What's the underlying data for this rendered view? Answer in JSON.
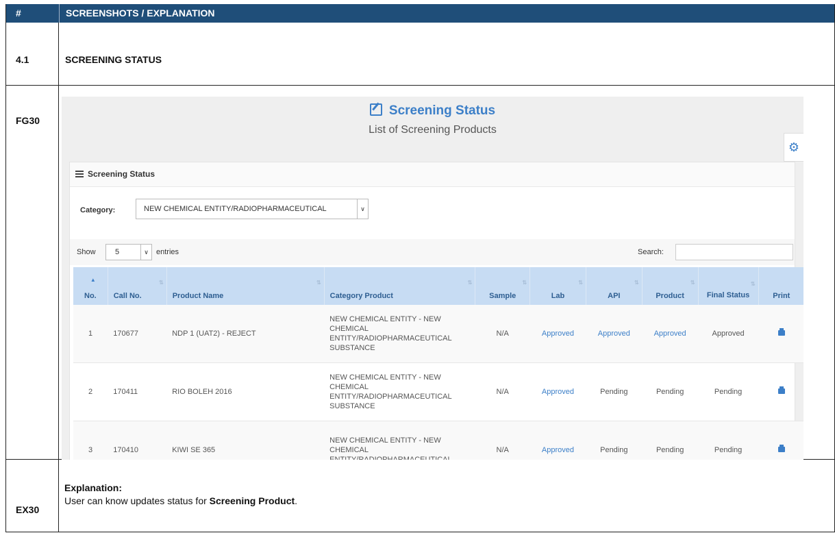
{
  "doc": {
    "col1_header": "#",
    "col2_header": "SCREENSHOTS / EXPLANATION",
    "section_num": "4.1",
    "section_title": "SCREENING STATUS",
    "fig_label": "FG30",
    "ex_label": "EX30",
    "explain_heading": "Explanation:",
    "explain_prefix": "User can know updates status for ",
    "explain_bold": "Screening Product",
    "explain_suffix": "."
  },
  "app": {
    "title": "Screening Status",
    "subtitle": "List of Screening Products",
    "panel_title": "Screening Status",
    "category_label": "Category:",
    "category_value": "NEW CHEMICAL ENTITY/RADIOPHARMACEUTICAL",
    "show_label": "Show",
    "entries_value": "5",
    "entries_label": "entries",
    "search_label": "Search:",
    "colors": {
      "accent": "#3c7fc8",
      "header_bg": "#1f4e79",
      "th_bg": "#c7dcf3"
    },
    "icons": [
      "edit-icon",
      "gear-icon",
      "list-icon",
      "print-icon",
      "sort-icon"
    ]
  },
  "table": {
    "headers": [
      "No.",
      "Call No.",
      "Product Name",
      "Category Product",
      "Sample",
      "Lab",
      "API",
      "Product",
      "Final Status",
      "Print"
    ],
    "rows": [
      {
        "no": "1",
        "call": "170677",
        "name": "NDP 1 (UAT2) - REJECT",
        "category": "NEW CHEMICAL ENTITY - NEW CHEMICAL ENTITY/RADIOPHARMACEUTICAL SUBSTANCE",
        "sample": "N/A",
        "lab": "Approved",
        "api": "Approved",
        "product": "Approved",
        "final": "Approved"
      },
      {
        "no": "2",
        "call": "170411",
        "name": "RIO BOLEH 2016",
        "category": "NEW CHEMICAL ENTITY - NEW CHEMICAL ENTITY/RADIOPHARMACEUTICAL SUBSTANCE",
        "sample": "N/A",
        "lab": "Approved",
        "api": "Pending",
        "product": "Pending",
        "final": "Pending"
      },
      {
        "no": "3",
        "call": "170410",
        "name": "KIWI SE 365",
        "category": "NEW CHEMICAL ENTITY - NEW CHEMICAL ENTITY/RADIOPHARMACEUTICAL",
        "sample": "N/A",
        "lab": "Approved",
        "api": "Pending",
        "product": "Pending",
        "final": "Pending"
      }
    ]
  }
}
